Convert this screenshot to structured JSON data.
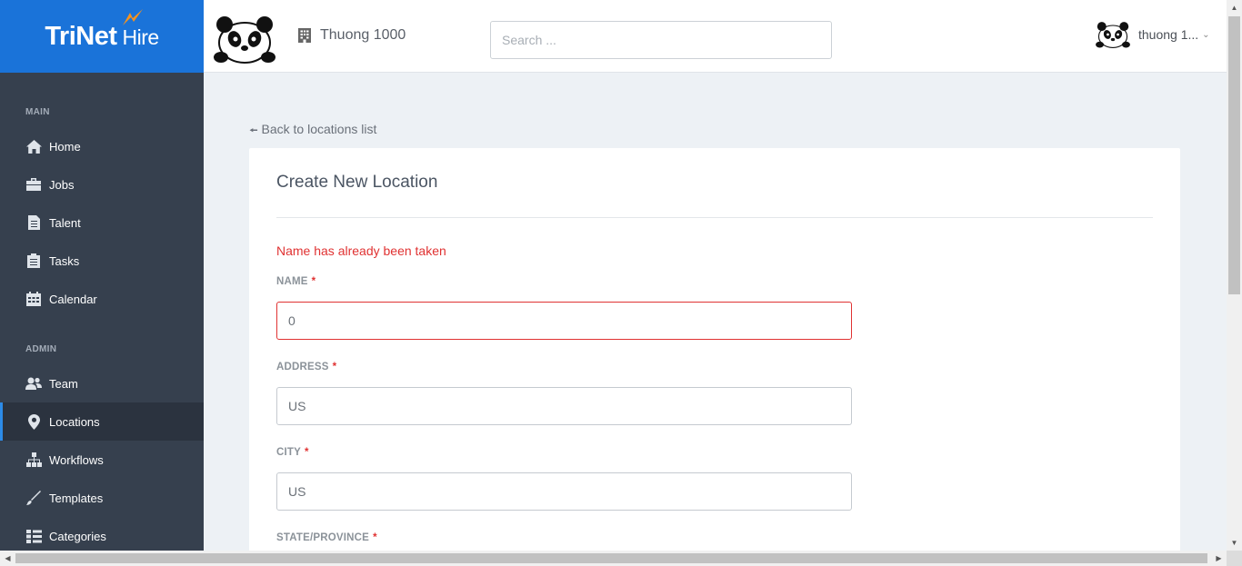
{
  "brand": {
    "name": "TriNet",
    "product": "Hire",
    "brand_color": "#1a73d9"
  },
  "topbar": {
    "company_name": "Thuong 1000",
    "search_placeholder": "Search ...",
    "user_name": "thuong 1..."
  },
  "sidebar": {
    "main_label": "MAIN",
    "admin_label": "ADMIN",
    "main_items": [
      {
        "label": "Home",
        "icon": "home-icon"
      },
      {
        "label": "Jobs",
        "icon": "briefcase-icon"
      },
      {
        "label": "Talent",
        "icon": "document-icon"
      },
      {
        "label": "Tasks",
        "icon": "clipboard-icon"
      },
      {
        "label": "Calendar",
        "icon": "calendar-icon"
      }
    ],
    "admin_items": [
      {
        "label": "Team",
        "icon": "team-icon"
      },
      {
        "label": "Locations",
        "icon": "map-pin-icon",
        "active": true
      },
      {
        "label": "Workflows",
        "icon": "sitemap-icon"
      },
      {
        "label": "Templates",
        "icon": "brush-icon"
      },
      {
        "label": "Categories",
        "icon": "list-icon"
      }
    ]
  },
  "main": {
    "back_link": "Back to locations list",
    "form_title": "Create New Location",
    "error_message": "Name has already been taken",
    "fields": [
      {
        "label": "NAME",
        "required": "*",
        "value": "0"
      },
      {
        "label": "ADDRESS",
        "required": "*",
        "value": "US"
      },
      {
        "label": "CITY",
        "required": "*",
        "value": "US"
      },
      {
        "label": "STATE/PROVINCE",
        "required": "*"
      }
    ],
    "error_color": "#e03232"
  }
}
